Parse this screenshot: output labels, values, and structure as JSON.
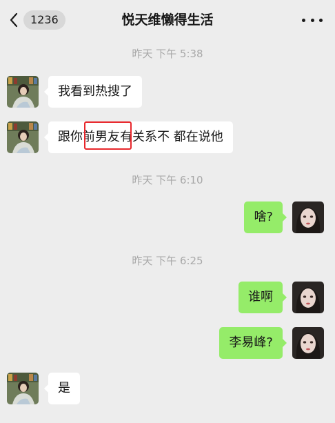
{
  "header": {
    "unread_count": "1236",
    "title": "悦天维懒得生活"
  },
  "messages": [
    {
      "type": "time",
      "text": "昨天 下午 5:38"
    },
    {
      "type": "left",
      "text": "我看到热搜了"
    },
    {
      "type": "left",
      "text": "跟你前男友有关系不 都在说他",
      "highlighted": "前男友"
    },
    {
      "type": "time",
      "text": "昨天 下午 6:10"
    },
    {
      "type": "right",
      "text": "啥?"
    },
    {
      "type": "time",
      "text": "昨天 下午 6:25"
    },
    {
      "type": "right",
      "text": "谁啊"
    },
    {
      "type": "right",
      "text": "李易峰?"
    },
    {
      "type": "left",
      "text": "是"
    }
  ],
  "colors": {
    "background": "#ededed",
    "sent_bubble": "#95ec69",
    "received_bubble": "#ffffff",
    "highlight": "#e8262b"
  }
}
